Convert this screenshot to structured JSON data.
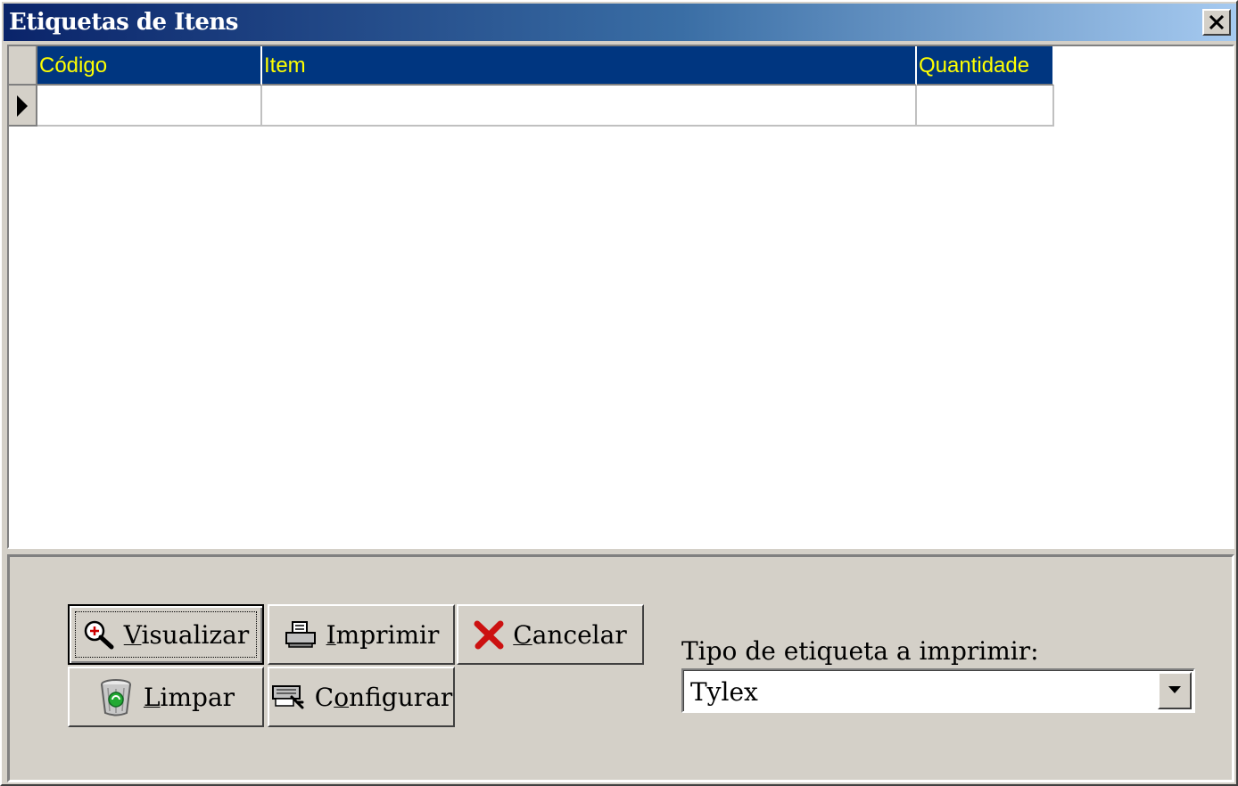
{
  "window": {
    "title": "Etiquetas de Itens",
    "close_icon": "close-x-icon"
  },
  "grid": {
    "columns": [
      "Código",
      "Item",
      "Quantidade"
    ],
    "rows": [
      {
        "codigo": "",
        "item": "",
        "quantidade": ""
      }
    ],
    "header_bg": "#003680",
    "header_fg": "#ffff00",
    "row_indicator_icon": "current-row-arrow-icon"
  },
  "actions": {
    "visualizar": {
      "label_first": "V",
      "label_rest": "isualizar",
      "icon": "zoom-magnifier-icon"
    },
    "imprimir": {
      "label_first": "I",
      "label_rest": "mprimir",
      "icon": "printer-icon"
    },
    "cancelar": {
      "label_first": "C",
      "label_rest": "ancelar",
      "icon": "red-x-icon"
    },
    "limpar": {
      "label_first": "L",
      "label_rest": "impar",
      "icon": "recycle-bin-icon"
    },
    "configurar": {
      "label_pre": "C",
      "label_accel": "o",
      "label_rest": "nfigurar",
      "icon": "printer-setup-icon"
    }
  },
  "label_type": {
    "label": "Tipo de etiqueta a imprimir:",
    "value": "Tylex",
    "dropdown_icon": "chevron-down-icon"
  }
}
